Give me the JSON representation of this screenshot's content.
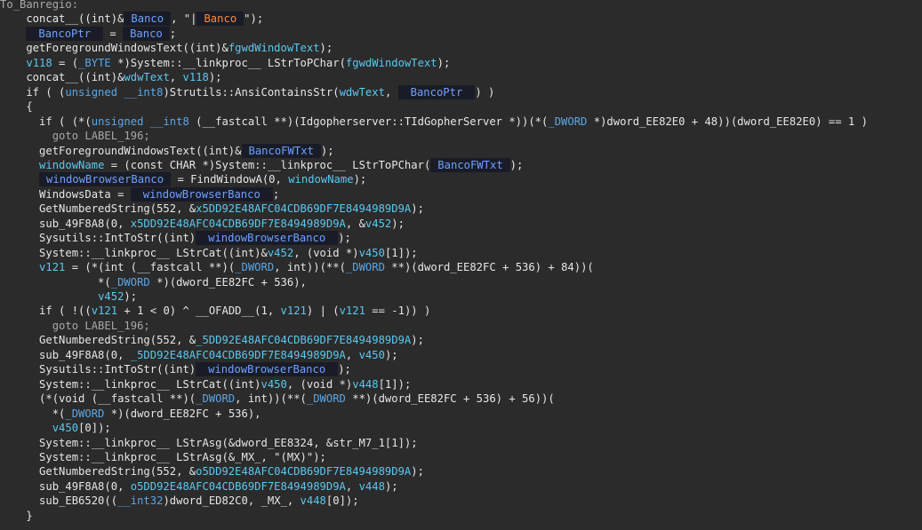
{
  "colors": {
    "background": "#2b2b2b",
    "text": "#e8e8e8",
    "variable": "#5ac8f0",
    "keyword": "#5aa6e6",
    "redaction_bg": "#191c27",
    "redaction_text_blue": "#6fa0ff",
    "redaction_text_orange": "#ff8a3a"
  },
  "lines": [
    [
      {
        "t": "To_Banregio:",
        "c": "label"
      }
    ],
    [
      {
        "t": "    concat__((int)&",
        "c": "k"
      },
      {
        "t": "Banco",
        "c": "tag"
      },
      {
        "t": ", \"|",
        "c": "k"
      },
      {
        "t": "Banco",
        "c": "tag orange"
      },
      {
        "t": "\");",
        "c": "k"
      }
    ],
    [
      {
        "t": "    ",
        "c": "k"
      },
      {
        "t": "BancoPtr",
        "c": "tag wide"
      },
      {
        "t": " = ",
        "c": "k"
      },
      {
        "t": "Banco",
        "c": "tag"
      },
      {
        "t": ";",
        "c": "k"
      }
    ],
    [
      {
        "t": "    getForegroundWindowsText((int)&",
        "c": "k"
      },
      {
        "t": "fgwdWindowText",
        "c": "var"
      },
      {
        "t": ");",
        "c": "k"
      }
    ],
    [
      {
        "t": "    ",
        "c": "k"
      },
      {
        "t": "v118",
        "c": "var"
      },
      {
        "t": " = (",
        "c": "k"
      },
      {
        "t": "_BYTE",
        "c": "kw"
      },
      {
        "t": " *)System::__linkproc__ LStrToPChar(",
        "c": "k"
      },
      {
        "t": "fgwdWindowText",
        "c": "var"
      },
      {
        "t": ");",
        "c": "k"
      }
    ],
    [
      {
        "t": "    concat__((int)&",
        "c": "k"
      },
      {
        "t": "wdwText",
        "c": "var"
      },
      {
        "t": ", ",
        "c": "k"
      },
      {
        "t": "v118",
        "c": "var"
      },
      {
        "t": ");",
        "c": "k"
      }
    ],
    [
      {
        "t": "    if ( (",
        "c": "k"
      },
      {
        "t": "unsigned __int8",
        "c": "kw"
      },
      {
        "t": ")Strutils::AnsiContainsStr(",
        "c": "k"
      },
      {
        "t": "wdwText",
        "c": "var"
      },
      {
        "t": ", ",
        "c": "k"
      },
      {
        "t": "BancoPtr",
        "c": "tag wide"
      },
      {
        "t": ") )",
        "c": "k"
      }
    ],
    [
      {
        "t": "    {",
        "c": "k"
      }
    ],
    [
      {
        "t": "      if ( (*(",
        "c": "k"
      },
      {
        "t": "unsigned __int8",
        "c": "kw"
      },
      {
        "t": " (__fastcall **)(Idgopherserver::TIdGopherServer *))(*(",
        "c": "k"
      },
      {
        "t": "_DWORD",
        "c": "kw"
      },
      {
        "t": " *)dword_EE82E0 + 48))(dword_EE82E0) == 1 )",
        "c": "k"
      }
    ],
    [
      {
        "t": "        goto LABEL_196;",
        "c": "label"
      }
    ],
    [
      {
        "t": "      getForegroundWindowsText((int)&",
        "c": "k"
      },
      {
        "t": "BancoFWTxt",
        "c": "tag"
      },
      {
        "t": ");",
        "c": "k"
      }
    ],
    [
      {
        "t": "      ",
        "c": "k"
      },
      {
        "t": "windowName",
        "c": "var"
      },
      {
        "t": " = (const CHAR *)System::__linkproc__ LStrToPChar(",
        "c": "k"
      },
      {
        "t": "BancoFWTxt",
        "c": "tag"
      },
      {
        "t": ");",
        "c": "k"
      }
    ],
    [
      {
        "t": "      ",
        "c": "k"
      },
      {
        "t": "windowBrowserBanco",
        "c": "tag"
      },
      {
        "t": " = FindWindowA(0, ",
        "c": "k"
      },
      {
        "t": "windowName",
        "c": "var"
      },
      {
        "t": ");",
        "c": "k"
      }
    ],
    [
      {
        "t": "      WindowsData = ",
        "c": "k"
      },
      {
        "t": "windowBrowserBanco",
        "c": "tag wide"
      },
      {
        "t": ";",
        "c": "k"
      }
    ],
    [
      {
        "t": "      GetNumberedString(552, &",
        "c": "k"
      },
      {
        "t": "x5DD92E48AFC04CDB69DF7E8494989D9A",
        "c": "var"
      },
      {
        "t": ");",
        "c": "k"
      }
    ],
    [
      {
        "t": "      sub_49F8A8(0, ",
        "c": "k"
      },
      {
        "t": "x5DD92E48AFC04CDB69DF7E8494989D9A",
        "c": "var"
      },
      {
        "t": ", &",
        "c": "k"
      },
      {
        "t": "v452",
        "c": "var"
      },
      {
        "t": ");",
        "c": "k"
      }
    ],
    [
      {
        "t": "      Sysutils::IntToStr((int)",
        "c": "k"
      },
      {
        "t": "windowBrowserBanco",
        "c": "tag wide"
      },
      {
        "t": ");",
        "c": "k"
      }
    ],
    [
      {
        "t": "      System::__linkproc__ LStrCat((int)&",
        "c": "k"
      },
      {
        "t": "v452",
        "c": "var"
      },
      {
        "t": ", (void *)",
        "c": "k"
      },
      {
        "t": "v450",
        "c": "var"
      },
      {
        "t": "[1]);",
        "c": "k"
      }
    ],
    [
      {
        "t": "      ",
        "c": "k"
      },
      {
        "t": "v121",
        "c": "var"
      },
      {
        "t": " = (*(int (__fastcall **)(",
        "c": "k"
      },
      {
        "t": "_DWORD",
        "c": "kw"
      },
      {
        "t": ", int))(**(",
        "c": "k"
      },
      {
        "t": "_DWORD",
        "c": "kw"
      },
      {
        "t": " **)(dword_EE82FC + 536) + 84))(",
        "c": "k"
      }
    ],
    [
      {
        "t": "               *(",
        "c": "k"
      },
      {
        "t": "_DWORD",
        "c": "kw"
      },
      {
        "t": " *)(dword_EE82FC + 536),",
        "c": "k"
      }
    ],
    [
      {
        "t": "               ",
        "c": "k"
      },
      {
        "t": "v452",
        "c": "var"
      },
      {
        "t": ");",
        "c": "k"
      }
    ],
    [
      {
        "t": "      if ( !((",
        "c": "k"
      },
      {
        "t": "v121",
        "c": "var"
      },
      {
        "t": " + 1 < 0) ^ __OFADD__(1, ",
        "c": "k"
      },
      {
        "t": "v121",
        "c": "var"
      },
      {
        "t": ") | (",
        "c": "k"
      },
      {
        "t": "v121",
        "c": "var"
      },
      {
        "t": " == -1)) )",
        "c": "k"
      }
    ],
    [
      {
        "t": "        goto LABEL_196;",
        "c": "label"
      }
    ],
    [
      {
        "t": "      GetNumberedString(552, &",
        "c": "k"
      },
      {
        "t": "_5DD92E48AFC04CDB69DF7E8494989D9A",
        "c": "var"
      },
      {
        "t": ");",
        "c": "k"
      }
    ],
    [
      {
        "t": "      sub_49F8A8(0, ",
        "c": "k"
      },
      {
        "t": "_5DD92E48AFC04CDB69DF7E8494989D9A",
        "c": "var"
      },
      {
        "t": ", ",
        "c": "k"
      },
      {
        "t": "v450",
        "c": "var"
      },
      {
        "t": ");",
        "c": "k"
      }
    ],
    [
      {
        "t": "      Sysutils::IntToStr((int)",
        "c": "k"
      },
      {
        "t": "windowBrowserBanco",
        "c": "tag wide"
      },
      {
        "t": ");",
        "c": "k"
      }
    ],
    [
      {
        "t": "      System::__linkproc__ LStrCat((int)",
        "c": "k"
      },
      {
        "t": "v450",
        "c": "var"
      },
      {
        "t": ", (void *)",
        "c": "k"
      },
      {
        "t": "v448",
        "c": "var"
      },
      {
        "t": "[1]);",
        "c": "k"
      }
    ],
    [
      {
        "t": "      (*(void (__fastcall **)(",
        "c": "k"
      },
      {
        "t": "_DWORD",
        "c": "kw"
      },
      {
        "t": ", int))(**(",
        "c": "k"
      },
      {
        "t": "_DWORD",
        "c": "kw"
      },
      {
        "t": " **)(dword_EE82FC + 536) + 56))(",
        "c": "k"
      }
    ],
    [
      {
        "t": "        *(",
        "c": "k"
      },
      {
        "t": "_DWORD",
        "c": "kw"
      },
      {
        "t": " *)(dword_EE82FC + 536),",
        "c": "k"
      }
    ],
    [
      {
        "t": "        ",
        "c": "k"
      },
      {
        "t": "v450",
        "c": "var"
      },
      {
        "t": "[0]);",
        "c": "k"
      }
    ],
    [
      {
        "t": "      System::__linkproc__ LStrAsg(&dword_EE8324, &str_M7_1[1]);",
        "c": "k"
      }
    ],
    [
      {
        "t": "      System::__linkproc__ LStrAsg(&_MX_, \"(MX)\");",
        "c": "k"
      }
    ],
    [
      {
        "t": "      GetNumberedString(552, &",
        "c": "k"
      },
      {
        "t": "o5DD92E48AFC04CDB69DF7E8494989D9A",
        "c": "var"
      },
      {
        "t": ");",
        "c": "k"
      }
    ],
    [
      {
        "t": "      sub_49F8A8(0, ",
        "c": "k"
      },
      {
        "t": "o5DD92E48AFC04CDB69DF7E8494989D9A",
        "c": "var"
      },
      {
        "t": ", ",
        "c": "k"
      },
      {
        "t": "v448",
        "c": "var"
      },
      {
        "t": ");",
        "c": "k"
      }
    ],
    [
      {
        "t": "      sub_EB6520((",
        "c": "k"
      },
      {
        "t": "__int32",
        "c": "kw"
      },
      {
        "t": ")dword_ED82C0, _MX_, ",
        "c": "k"
      },
      {
        "t": "v448",
        "c": "var"
      },
      {
        "t": "[0]);",
        "c": "k"
      }
    ],
    [
      {
        "t": "    }",
        "c": "k"
      }
    ]
  ]
}
